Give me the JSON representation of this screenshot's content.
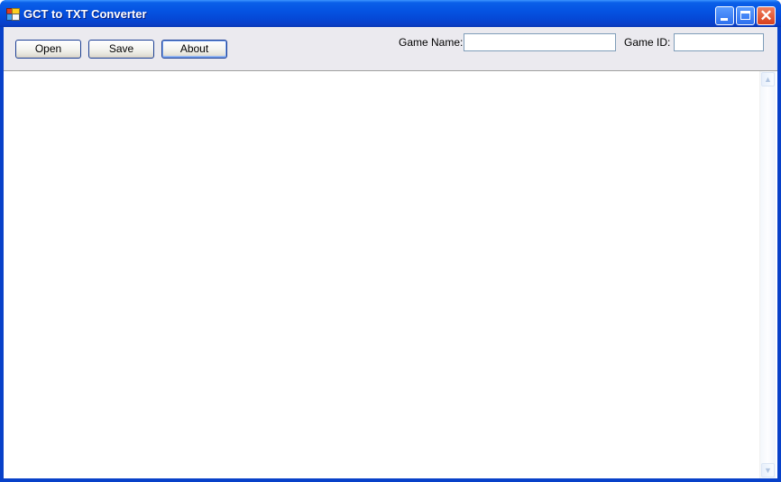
{
  "window": {
    "title": "GCT to TXT Converter",
    "controls": {
      "minimize_icon": "minimize-icon",
      "maximize_icon": "maximize-icon",
      "close_icon": "close-icon",
      "close_glyph": "✕"
    }
  },
  "toolbar": {
    "open_label": "Open",
    "save_label": "Save",
    "about_label": "About",
    "game_name_label": "Game Name:",
    "game_name_value": "",
    "game_id_label": "Game ID:",
    "game_id_value": ""
  },
  "editor": {
    "content": "",
    "scroll_up_glyph": "▲",
    "scroll_down_glyph": "▼"
  }
}
